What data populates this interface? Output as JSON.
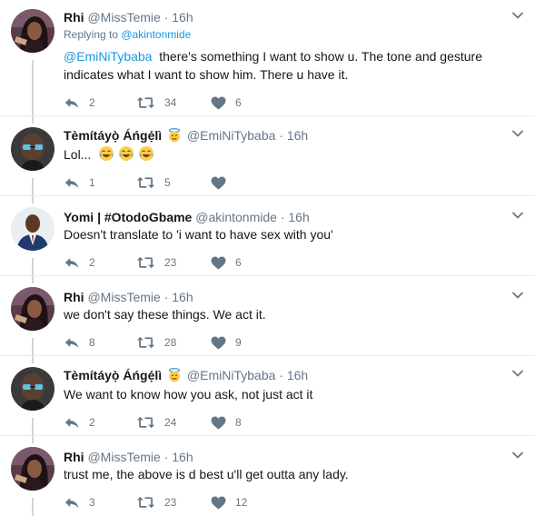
{
  "tweets": [
    {
      "name": "Rhi",
      "handle": "@MissTemie",
      "dot": "·",
      "time": "16h",
      "replying_label": "Replying to ",
      "replying_to": "@akintonmide",
      "mention": "@EmiNiTybaba",
      "text": "there's something I want to show u. The tone and gesture",
      "text2": "indicates what I want to show him. There u have it.",
      "replies": "2",
      "retweets": "34",
      "likes": "6"
    },
    {
      "name": "Tèmítáyọ̀ Áńgẹ́lì",
      "handle": "@EmiNiTybaba",
      "dot": "·",
      "time": "16h",
      "text": "Lol...",
      "replies": "1",
      "retweets": "5",
      "likes": ""
    },
    {
      "name": "Yomi | #OtodoGbame",
      "handle": "@akintonmide",
      "dot": "·",
      "time": "16h",
      "text": "Doesn't translate to 'i want to have sex with you'",
      "replies": "2",
      "retweets": "23",
      "likes": "6"
    },
    {
      "name": "Rhi",
      "handle": "@MissTemie",
      "dot": "·",
      "time": "16h",
      "text": "we don't say these things. We act it.",
      "replies": "8",
      "retweets": "28",
      "likes": "9"
    },
    {
      "name": "Tèmítáyọ̀ Áńgẹ́lì",
      "handle": "@EmiNiTybaba",
      "dot": "·",
      "time": "16h",
      "text": "We want to know how you ask, not just act it",
      "replies": "2",
      "retweets": "24",
      "likes": "8"
    },
    {
      "name": "Rhi",
      "handle": "@MissTemie",
      "dot": "·",
      "time": "16h",
      "text": "trust me, the above is d best u'll get outta any lady.",
      "replies": "3",
      "retweets": "23",
      "likes": "12"
    }
  ],
  "icons": {
    "reply": "reply-icon",
    "retweet": "retweet-icon",
    "like": "heart-icon",
    "more": "chevron-down-icon",
    "halo": "smiling-face-with-halo-emoji",
    "laugh": "face-with-tears-of-joy-emoji"
  },
  "colors": {
    "link": "#1b95e0",
    "muted": "#657786",
    "icon": "#657786",
    "thread": "#ccd6dd"
  }
}
